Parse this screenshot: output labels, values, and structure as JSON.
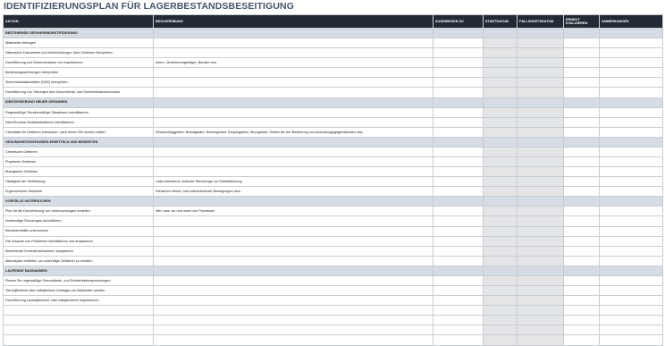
{
  "page": {
    "title": "IDENTIFIZIERUNGSPLAN FÜR LAGERBESTANDSBESEITIGUNG"
  },
  "table": {
    "headers": {
      "aktion": "AKTION",
      "beschreibung": "BESCHREIBUNG",
      "zugewiesen": "ZUGEWIESEN ZU",
      "startdatum": "STARTDATUM",
      "faelligkeit": "FÄLLIGKEITSDATUM",
      "erneut": "ERNEUT EVALUIEREN",
      "anmerkungen": "ANMERKUNGEN"
    },
    "rows": [
      {
        "type": "section",
        "aktion": "BESTEHENDE GEFAHRENIDENTIFIZIERUNG",
        "beschreibung": ""
      },
      {
        "type": "item",
        "aktion": "Mitarbeiter befragen",
        "beschreibung": ""
      },
      {
        "type": "item",
        "aktion": "Historische Dokumente und Aufzeichnungen über Gefahren überprüfen",
        "beschreibung": ""
      },
      {
        "type": "item",
        "aktion": "Durchführung und Dokumentation von Inspektionen",
        "beschreibung": "Intern, Versicherungsträger, Berater usw."
      },
      {
        "type": "item",
        "aktion": "Bedienungsanleitungen überprüfen",
        "beschreibung": ""
      },
      {
        "type": "item",
        "aktion": "Sicherheitsdatenblätter (SDS) überprüfen",
        "beschreibung": ""
      },
      {
        "type": "item",
        "aktion": "Durchführung von Sitzungen des Gesundheits- und Sicherheitsausschusses",
        "beschreibung": ""
      },
      {
        "type": "section",
        "aktion": "IDENTIFIZIERUNG NEUER GEFAHREN",
        "beschreibung": ""
      },
      {
        "type": "item",
        "aktion": "Regelmäßige/ Routinemäßige Situationen identifizieren",
        "beschreibung": ""
      },
      {
        "type": "item",
        "aktion": "Nicht-Routine-/Notfallsituationen identifizieren",
        "beschreibung": ""
      },
      {
        "type": "item",
        "aktion": "Checkliste für Gefahren entwickeln, nach denen Sie suchen sollten",
        "beschreibung": "Stromschlaggefahr, Brandgefahr, Rutschgefahr, Stolpergefahr, Sturzgefahr, Gefahr bei der Bedienung von Ausrüstungsgegenständen usw."
      },
      {
        "type": "section",
        "aktion": "GESUNDHEITSGEFAHREN ERMITTELN UND BEWERTEN",
        "beschreibung": ""
      },
      {
        "type": "item",
        "aktion": "Chemische Gefahren",
        "beschreibung": ""
      },
      {
        "type": "item",
        "aktion": "Physische Gefahren",
        "beschreibung": ""
      },
      {
        "type": "item",
        "aktion": "Biologische Gefahren",
        "beschreibung": ""
      },
      {
        "type": "item",
        "aktion": "Häufigkeit der Gefährdung",
        "beschreibung": "Luftprobenahme und/oder Werkzeuge zur Direktablesung"
      },
      {
        "type": "item",
        "aktion": "Ergonomische Gefahren",
        "beschreibung": "Schweres Heben, sich wiederholende Bewegungen usw."
      },
      {
        "type": "section",
        "aktion": "VORFÄLLE UNTERSUCHEN",
        "beschreibung": ""
      },
      {
        "type": "item",
        "aktion": "Plan für die Durchführung von Untersuchungen erstellen",
        "beschreibung": "Wer, was, wo und wann von Prozessen"
      },
      {
        "type": "item",
        "aktion": "Notwendige Schulungen durchführen",
        "beschreibung": ""
      },
      {
        "type": "item",
        "aktion": "Beinahevorfälle untersuchen",
        "beschreibung": ""
      },
      {
        "type": "item",
        "aktion": "Die Ursache von Problemen identifizieren und analysieren",
        "beschreibung": ""
      },
      {
        "type": "item",
        "aktion": "Bestehende Kontrollmaßnahmen analysieren",
        "beschreibung": ""
      },
      {
        "type": "item",
        "aktion": "Aktionsplan erstellen, um zukünftige Gefahren zu mindern",
        "beschreibung": ""
      },
      {
        "type": "section",
        "aktion": "LAUFENDE MAßNAHMEN",
        "beschreibung": ""
      },
      {
        "type": "item",
        "aktion": "Planen Sie regelmäßige Gesundheits- und Sicherheitsbesprechungen",
        "beschreibung": ""
      },
      {
        "type": "item",
        "aktion": "Vierteljährliche oder halbjährliche Umfragen an Mitarbeiter senden",
        "beschreibung": ""
      },
      {
        "type": "item",
        "aktion": "Durchführung vierteljährlicher oder halbjährlicher Inspektionen",
        "beschreibung": ""
      },
      {
        "type": "item",
        "aktion": "",
        "beschreibung": ""
      },
      {
        "type": "item",
        "aktion": "",
        "beschreibung": ""
      },
      {
        "type": "item",
        "aktion": "",
        "beschreibung": ""
      },
      {
        "type": "item",
        "aktion": "",
        "beschreibung": ""
      }
    ]
  }
}
